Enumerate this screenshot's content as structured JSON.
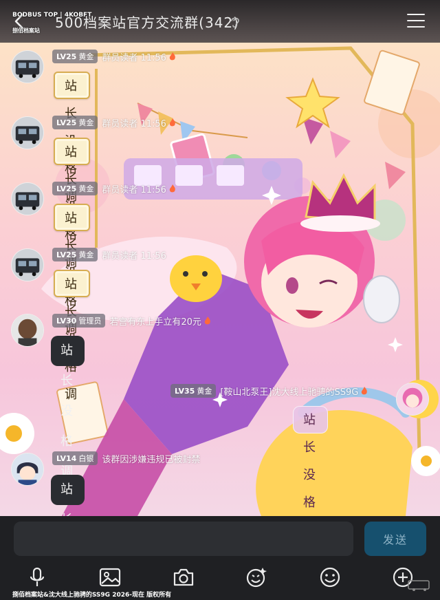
{
  "header": {
    "title": "500档案站官方交流群(342)",
    "watermark_line1": "BODBUS TOP | 4KOBFT",
    "watermark_line2": "捌佰档案站"
  },
  "messages": [
    {
      "level": "LV25",
      "rank": "黄金",
      "nick": "群员读者",
      "time": "11:56",
      "text": "站长没格调",
      "style": "parchment"
    },
    {
      "level": "LV25",
      "rank": "黄金",
      "nick": "群员读者",
      "time": "11:56",
      "text": "站长没格调",
      "style": "parchment"
    },
    {
      "level": "LV25",
      "rank": "黄金",
      "nick": "群员读者",
      "time": "11:56",
      "text": "站长没格调",
      "style": "parchment"
    },
    {
      "level": "LV25",
      "rank": "黄金",
      "nick": "群员读者",
      "time": "11:56",
      "text": "站长没格调",
      "style": "parchment"
    },
    {
      "level": "LV30",
      "rank": "管理员",
      "nick": "若宫有东上手立有20元",
      "text": "站长没格调",
      "style": "dark"
    },
    {
      "level": "LV35",
      "rank": "黄金",
      "nick": "[鞍山北泵王]沈大线上驰骋的SS9G",
      "text": "站长没格调",
      "style": "pink",
      "self": true
    },
    {
      "level": "LV14",
      "rank": "白银",
      "nick": "该群因涉嫌违规已被封禁",
      "text": "站长没格调",
      "style": "dark"
    }
  ],
  "composer": {
    "input_value": "",
    "send_label": "发送"
  },
  "toolbar": [
    "microphone-icon",
    "image-icon",
    "camera-icon",
    "sticker-icon",
    "emoji-icon",
    "plus-icon"
  ],
  "footer": {
    "watermark": "捌佰档案站&沈大线上驰骋的SS9G 2026-现在 版权所有"
  },
  "colors": {
    "header_bg": "#1e1e21",
    "bubble_parchment": "#fbf1d0",
    "bubble_dark": "#2a2c31",
    "bubble_pink": "#e8c4e6",
    "send_button": "#16506e",
    "composer_bg": "#1f2023"
  }
}
